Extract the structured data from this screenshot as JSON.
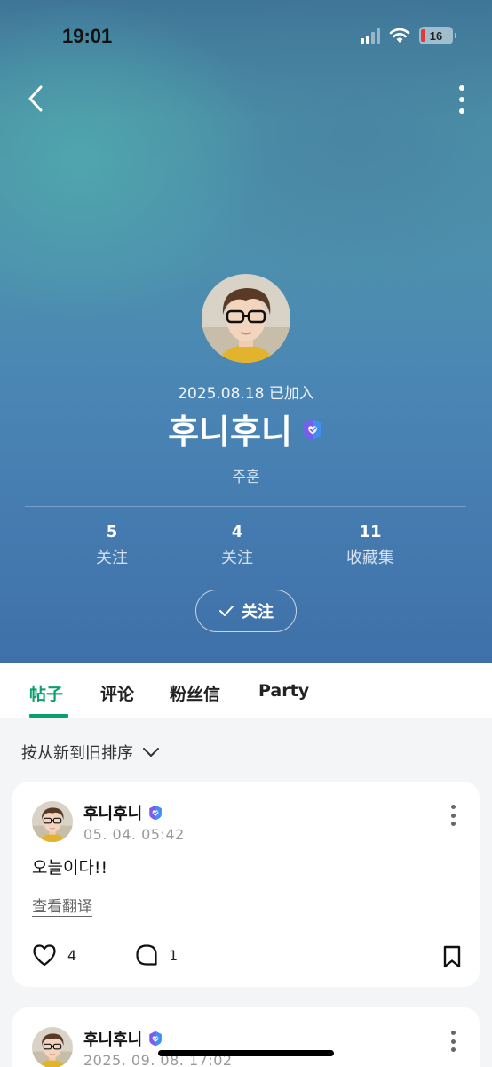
{
  "status": {
    "time": "19:01",
    "battery": "16"
  },
  "profile": {
    "joined": "2025.08.18 已加入",
    "name": "후니후니",
    "subname": "주훈",
    "stats": [
      {
        "num": "5",
        "label": "关注"
      },
      {
        "num": "4",
        "label": "关注"
      },
      {
        "num": "11",
        "label": "收藏集"
      }
    ],
    "follow_label": "关注"
  },
  "tabs": [
    {
      "label": "帖子",
      "active": true
    },
    {
      "label": "评论",
      "active": false
    },
    {
      "label": "粉丝信",
      "active": false
    },
    {
      "label": "Party",
      "active": false
    }
  ],
  "sort_label": "按从新到旧排序",
  "posts": [
    {
      "author": "후니후니",
      "time": "05. 04. 05:42",
      "text": "오늘이다!!",
      "translate": "查看翻译",
      "likes": "4",
      "comments": "1"
    },
    {
      "author": "후니후니",
      "time": "2025. 09. 08. 17:02"
    }
  ],
  "colors": {
    "accent": "#0aa06e",
    "hero_top": "#3f7598",
    "hero_bottom": "#3f70a9"
  }
}
